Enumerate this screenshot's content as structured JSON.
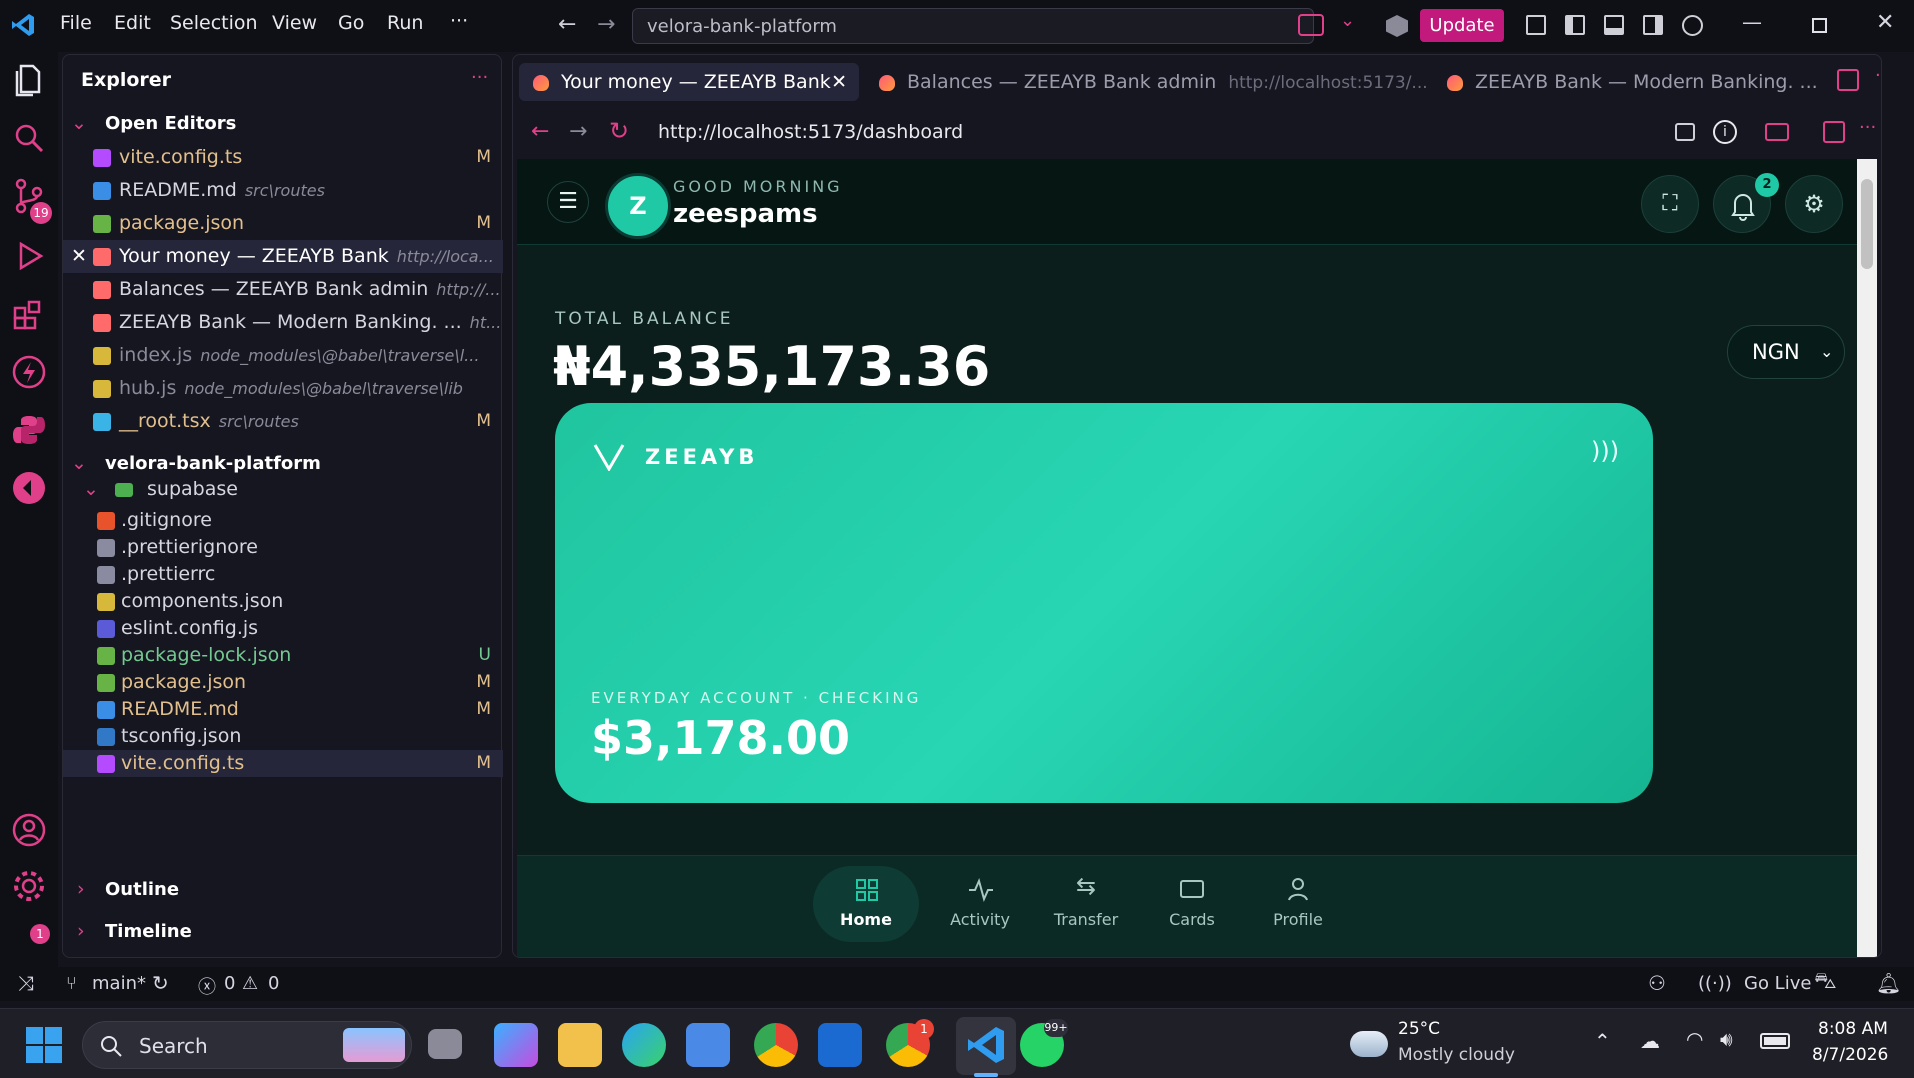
{
  "titlebar": {
    "menus": [
      "File",
      "Edit",
      "Selection",
      "View",
      "Go",
      "Run",
      "···"
    ],
    "command_center": "velora-bank-platform",
    "update_label": "Update"
  },
  "activity": {
    "scm_badge": "19",
    "settings_badge": "1"
  },
  "sidebar": {
    "title": "Explorer",
    "open_editors_label": "Open Editors",
    "open_editors": [
      {
        "name": "vite.config.ts",
        "path": "",
        "status": "M",
        "color": "#e2c08d",
        "icon": "vite-icon",
        "icolor": "#b44bff"
      },
      {
        "name": "README.md",
        "path": "src\\routes",
        "status": "",
        "color": "#d6d6e0",
        "icon": "info-icon",
        "icolor": "#3a8ee6"
      },
      {
        "name": "package.json",
        "path": "",
        "status": "M",
        "color": "#e2c08d",
        "icon": "node-icon",
        "icolor": "#67b346"
      },
      {
        "name": "Your money — ZEEAYB Bank",
        "path": "http://loca...",
        "status": "",
        "color": "#ffffff",
        "icon": "browser-icon",
        "icolor": "#ff6a6a",
        "active": true
      },
      {
        "name": "Balances — ZEEAYB Bank admin",
        "path": "http://...",
        "status": "",
        "color": "#d6d6e0",
        "icon": "browser-icon",
        "icolor": "#ff6a6a"
      },
      {
        "name": "ZEEAYB Bank — Modern Banking. ...",
        "path": "ht...",
        "status": "",
        "color": "#d6d6e0",
        "icon": "browser-icon",
        "icolor": "#ff6a6a"
      },
      {
        "name": "index.js",
        "path": "node_modules\\@babel\\traverse\\l...",
        "status": "",
        "color": "#8a8a98",
        "icon": "js-icon",
        "icolor": "#d8b83a"
      },
      {
        "name": "hub.js",
        "path": "node_modules\\@babel\\traverse\\lib",
        "status": "",
        "color": "#8a8a98",
        "icon": "js-icon",
        "icolor": "#d8b83a"
      },
      {
        "name": "__root.tsx",
        "path": "src\\routes",
        "status": "M",
        "color": "#e2c08d",
        "icon": "react-icon",
        "icolor": "#3ab4e6"
      }
    ],
    "project_label": "velora-bank-platform",
    "folder": "supabase",
    "files": [
      {
        "name": ".gitignore",
        "status": "",
        "color": "#d6d6e0",
        "icon": "git-icon",
        "icolor": "#e8532b"
      },
      {
        "name": ".prettierignore",
        "status": "",
        "color": "#d6d6e0",
        "icon": "prettier-icon",
        "icolor": "#8a8aa0"
      },
      {
        "name": ".prettierrc",
        "status": "",
        "color": "#d6d6e0",
        "icon": "prettier-icon",
        "icolor": "#8a8aa0"
      },
      {
        "name": "components.json",
        "status": "",
        "color": "#d6d6e0",
        "icon": "braces-icon",
        "icolor": "#d8b83a"
      },
      {
        "name": "eslint.config.js",
        "status": "",
        "color": "#d6d6e0",
        "icon": "eslint-icon",
        "icolor": "#5b5bd8"
      },
      {
        "name": "package-lock.json",
        "status": "U",
        "color": "#73c991",
        "icon": "node-icon",
        "icolor": "#67b346"
      },
      {
        "name": "package.json",
        "status": "M",
        "color": "#e2c08d",
        "icon": "node-icon",
        "icolor": "#67b346"
      },
      {
        "name": "README.md",
        "status": "M",
        "color": "#e2c08d",
        "icon": "info-icon",
        "icolor": "#3a8ee6"
      },
      {
        "name": "tsconfig.json",
        "status": "",
        "color": "#d6d6e0",
        "icon": "tsconfig-icon",
        "icolor": "#3178c6"
      },
      {
        "name": "vite.config.ts",
        "status": "M",
        "color": "#e2c08d",
        "icon": "vite-icon",
        "icolor": "#b44bff",
        "selected": true
      }
    ],
    "outline_label": "Outline",
    "timeline_label": "Timeline"
  },
  "editor": {
    "tabs": [
      {
        "title": "Your money — ZEEAYB Bank",
        "url": ""
      },
      {
        "title": "Balances — ZEEAYB Bank admin",
        "url": "http://localhost:5173/..."
      },
      {
        "title": "ZEEAYB Bank — Modern Banking. ...",
        "url": ""
      }
    ],
    "url": "http://localhost:5173/dashboard"
  },
  "app": {
    "greeting": "GOOD MORNING",
    "username": "zeespams",
    "avatar_letter": "Z",
    "notif_count": "2",
    "total_label": "TOTAL BALANCE",
    "total_value": "₦4,335,173.36",
    "currency": "NGN",
    "card_brand": "ZEEAYB",
    "account_label": "EVERYDAY ACCOUNT · CHECKING",
    "account_balance": "$3,178.00",
    "nav": [
      "Home",
      "Activity",
      "Transfer",
      "Cards",
      "Profile"
    ]
  },
  "statusbar": {
    "branch": "main*",
    "errors": "0",
    "warnings": "0",
    "golive": "Go Live"
  },
  "taskbar": {
    "search": "Search",
    "weather_temp": "25°C",
    "weather_desc": "Mostly cloudy",
    "time": "8:08 AM",
    "date": "8/7/2026",
    "chrome_badge": "1",
    "whatsapp_badge": "99+"
  },
  "colors": {
    "accent": "#1fc9a6",
    "brand_pink": "#c2197d",
    "page_bg": "#0b1e1c"
  }
}
